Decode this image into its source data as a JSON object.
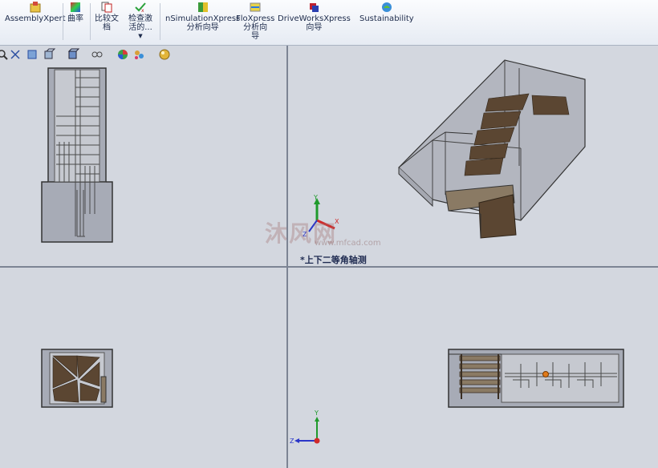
{
  "ribbon": {
    "items": [
      {
        "label": "AssemblyXpert"
      },
      {
        "label": "曲率"
      },
      {
        "label": "比较文档"
      },
      {
        "label": "检查激活的..."
      },
      {
        "label": "nSimulationXpress 分析向导"
      },
      {
        "label": "FloXpress 分析向导"
      },
      {
        "label": "DriveWorksXpress 向导"
      },
      {
        "label": "Sustainability"
      }
    ],
    "compare_l1": "比较文",
    "compare_l2": "档",
    "check_l1": "检查激",
    "check_l2": "活的...",
    "sim_l1": "nSimulationXpress",
    "sim_l2": "分析向导",
    "flo_l1": "FloXpress",
    "flo_l2": "分析向",
    "flo_l3": "导",
    "drive_l1": "DriveWorksXpress",
    "drive_l2": "向导"
  },
  "viewport": {
    "view_label": "*上下二等角轴测",
    "axis_y": "Y",
    "axis_x": "X",
    "axis_z": "Z"
  },
  "watermark": {
    "text": "沐风网",
    "url": "www.mfcad.com"
  },
  "colors": {
    "viewport_bg": "#d3d7df",
    "model_fill": "#a7abb6",
    "stair_brown": "#5b4632",
    "axis_green": "#1f9a2c",
    "axis_red": "#d02a2a",
    "axis_blue": "#2a36c8"
  }
}
